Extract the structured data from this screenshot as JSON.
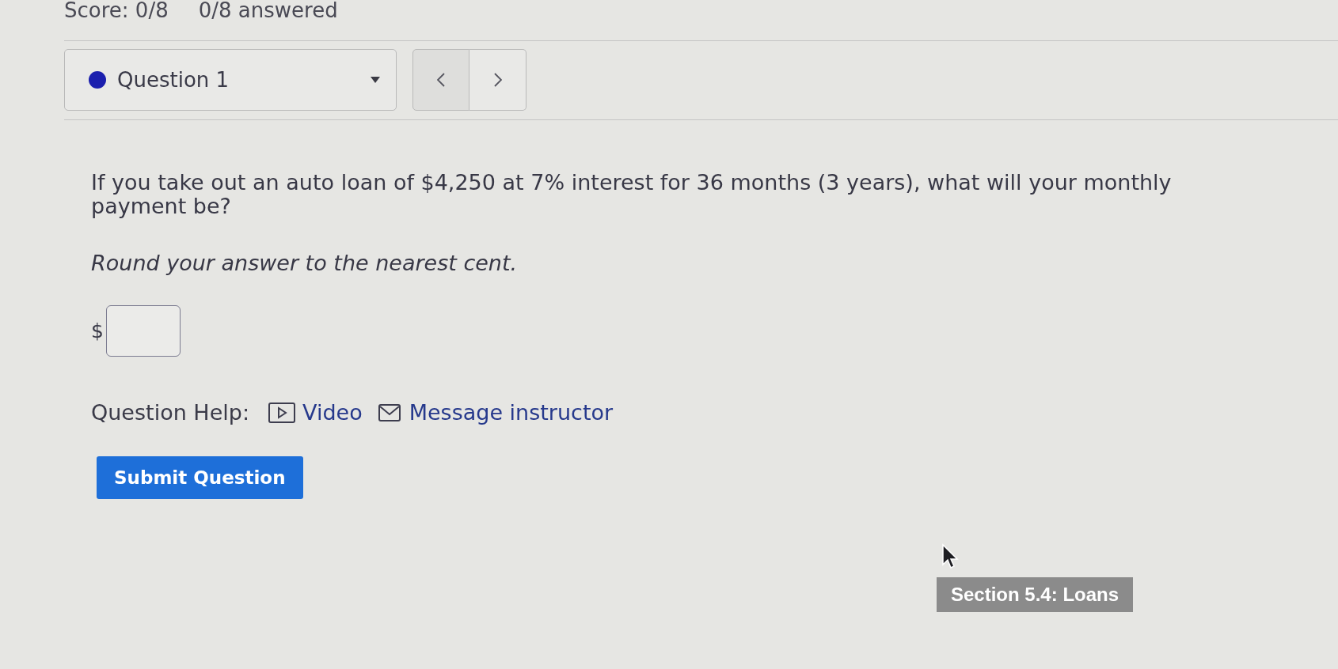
{
  "header": {
    "score": "Score: 0/8",
    "answered": "0/8 answered"
  },
  "question_selector": {
    "label": "Question 1"
  },
  "question": {
    "text": "If you take out an auto loan of $4,250 at 7% interest for 36 months (3 years), what will your monthly payment be?",
    "instruction": "Round your answer to the nearest cent.",
    "answer": {
      "prefix": "$"
    }
  },
  "help": {
    "label": "Question Help:",
    "links": [
      {
        "kind": "video",
        "label": "Video"
      },
      {
        "kind": "message",
        "label": "Message instructor"
      }
    ]
  },
  "submit": {
    "label": "Submit Question"
  },
  "tooltip": {
    "text": "Section 5.4: Loans"
  }
}
